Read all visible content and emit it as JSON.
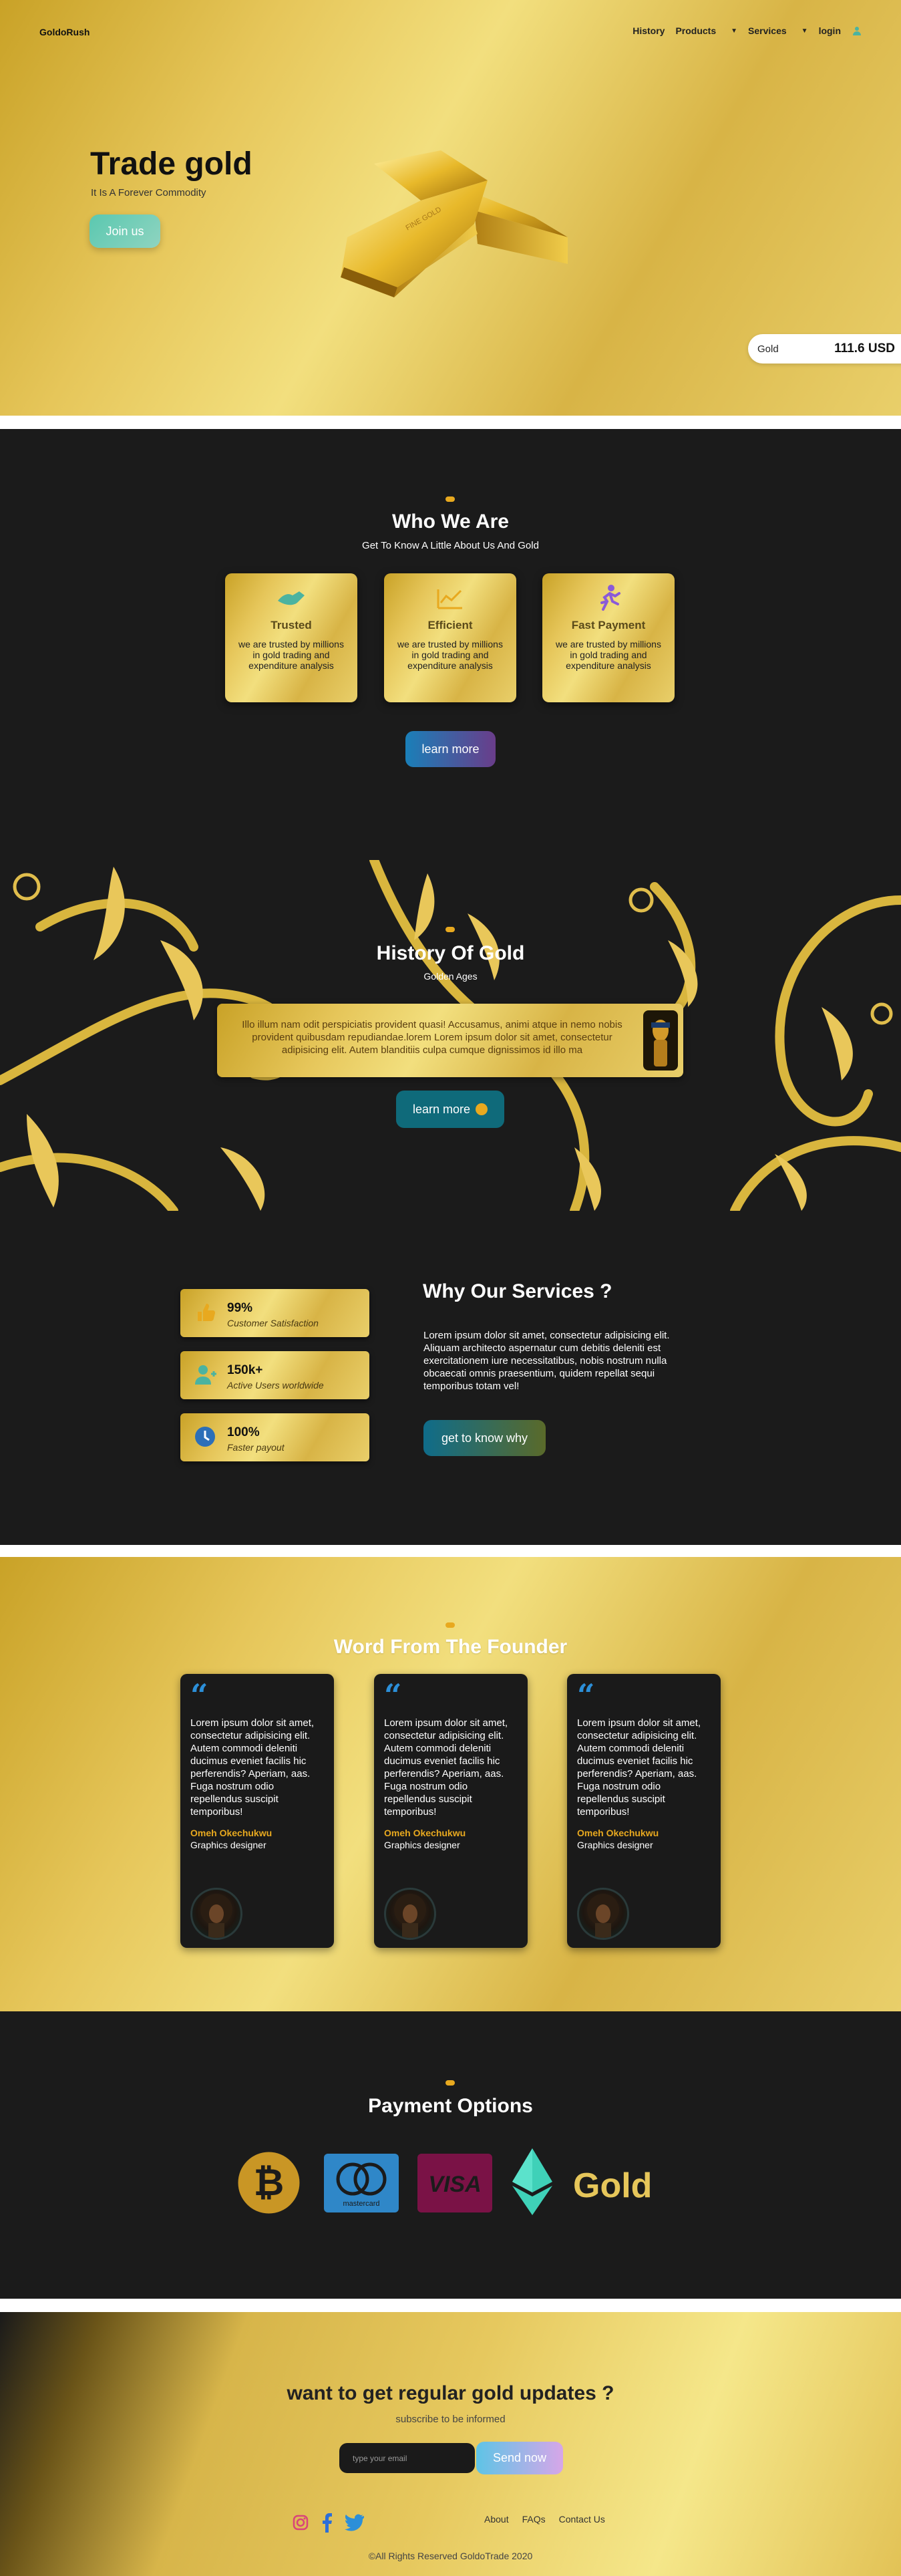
{
  "nav": {
    "logo": "GoldoRush",
    "items": [
      {
        "label": "History"
      },
      {
        "label": "Products"
      },
      {
        "label": "Services"
      },
      {
        "label": "login"
      }
    ]
  },
  "hero": {
    "title": "Trade gold",
    "subtitle": "It Is A Forever Commodity",
    "cta": "Join us",
    "price_label": "Gold",
    "price_value": "111.6 USD"
  },
  "who": {
    "title": "Who We Are",
    "subtitle": "Get To Know A Little About Us And Gold",
    "cards": [
      {
        "title": "Trusted",
        "icon": "handshake-icon",
        "desc": "we are trusted by millions in gold trading and expenditure analysis"
      },
      {
        "title": "Efficient",
        "icon": "chart-icon",
        "desc": "we are trusted by millions in gold trading and expenditure analysis"
      },
      {
        "title": "Fast Payment",
        "icon": "running-icon",
        "desc": "we are trusted by millions in gold trading and expenditure analysis"
      }
    ],
    "cta": "learn more"
  },
  "history": {
    "title": "History Of Gold",
    "subtitle": "Golden Ages",
    "text": "Illo illum nam odit perspiciatis provident quasi! Accusamus, animi atque in nemo nobis provident quibusdam repudiandae.lorem Lorem ipsum dolor sit amet, consectetur adipisicing elit. Autem blanditiis culpa cumque dignissimos id illo ma",
    "cta": "learn more"
  },
  "why": {
    "stats": [
      {
        "value": "99%",
        "label": "Customer Satisfaction",
        "icon": "thumbs-up-icon"
      },
      {
        "value": "150k+",
        "label": "Active Users worldwide",
        "icon": "user-icon"
      },
      {
        "value": "100%",
        "label": "Faster payout",
        "icon": "clock-icon"
      }
    ],
    "title": "Why Our Services ?",
    "text": "Lorem ipsum dolor sit amet, consectetur adipisicing elit. Aliquam architecto aspernatur cum debitis deleniti est exercitationem iure necessitatibus, nobis nostrum nulla obcaecati omnis praesentium, quidem repellat sequi temporibus totam vel!",
    "cta": "get to know why"
  },
  "founder": {
    "title": "Word From The Founder",
    "testimonials": [
      {
        "text": "Lorem ipsum dolor sit amet, consectetur adipisicing elit. Autem commodi deleniti ducimus eveniet facilis hic perferendis? Aperiam, aas. Fuga nostrum odio repellendus suscipit temporibus!",
        "name": "Omeh Okechukwu",
        "role": "Graphics designer"
      },
      {
        "text": "Lorem ipsum dolor sit amet, consectetur adipisicing elit. Autem commodi deleniti ducimus eveniet facilis hic perferendis? Aperiam, aas. Fuga nostrum odio repellendus suscipit temporibus!",
        "name": "Omeh Okechukwu",
        "role": "Graphics designer"
      },
      {
        "text": "Lorem ipsum dolor sit amet, consectetur adipisicing elit. Autem commodi deleniti ducimus eveniet facilis hic perferendis? Aperiam, aas. Fuga nostrum odio repellendus suscipit temporibus!",
        "name": "Omeh Okechukwu",
        "role": "Graphics designer"
      }
    ]
  },
  "payment": {
    "title": "Payment Options",
    "methods": [
      {
        "name": "bitcoin-icon"
      },
      {
        "name": "mastercard-icon",
        "caption": "mastercard"
      },
      {
        "name": "visa-icon",
        "caption": "VISA"
      },
      {
        "name": "ethereum-icon"
      },
      {
        "name": "gold-text",
        "caption": "Gold"
      }
    ]
  },
  "footer": {
    "title": "want to get regular gold updates ?",
    "subtitle": "subscribe to be informed",
    "email_placeholder": "type your email",
    "send": "Send now",
    "links": [
      "About",
      "FAQs",
      "Contact Us"
    ],
    "copyright": "©All Rights Reserved GoldoTrade 2020"
  },
  "colors": {
    "accent_orange": "#e8a91f",
    "dark": "#1b1b1b",
    "gold": "#e6c65a",
    "teal": "#5bc8b0",
    "quote_blue": "#2c8fd8"
  }
}
